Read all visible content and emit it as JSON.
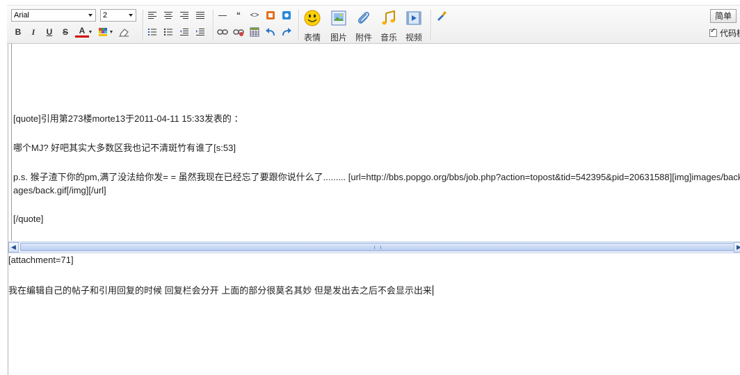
{
  "toolbar": {
    "font_value": "Arial",
    "size_value": "2",
    "bold_label": "B",
    "italic_label": "I",
    "underline_label": "U",
    "strike_label": "S",
    "fontcolor_label": "A",
    "quote_label": "“",
    "code_label": "<>",
    "emoticon_label": "表情",
    "image_label": "图片",
    "attach_label": "附件",
    "music_label": "音乐",
    "video_label": "视频",
    "mode_button_label": "简单",
    "code_check_label": "代码模式",
    "accent": "#e0a000"
  },
  "editor_top": {
    "quote_open": "[quote]引用第273楼morte13于2011-04-11 15:33发表的 ：",
    "line1": "哪个MJ? 好吧其实大多数区我也记不清斑竹有谁了[s:53]",
    "line2": "p.s. 猴子渣下你的pm,满了没法给你发= = 虽然我现在已经忘了要跟你说什么了......... [url=http://bbs.popgo.org/bbs/job.php?action=topost&tid=542395&pid=20631588][img]images/back.gif[/img][/url]",
    "line2_wrapped": "ages/back.gif[/img][/url]",
    "quote_close": "[/quote]"
  },
  "editor_bottom": {
    "attachment": "[attachment=71]",
    "message": "我在编辑自己的帖子和引用回复的时候 回复栏会分开 上面的部分很莫名其妙 但是发出去之后不会显示出来"
  }
}
